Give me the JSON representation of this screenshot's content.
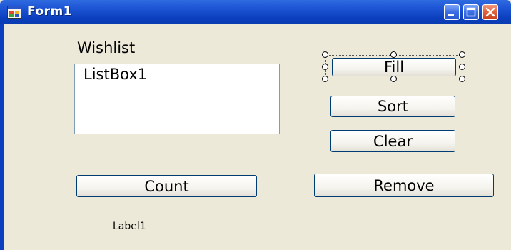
{
  "window": {
    "title": "Form1",
    "controls": [
      "minimize",
      "maximize",
      "close"
    ]
  },
  "form": {
    "wishlist_label": "Wishlist",
    "listbox_text": "ListBox1",
    "buttons": {
      "fill": "Fill",
      "sort": "Sort",
      "clear": "Clear",
      "count": "Count",
      "remove": "Remove"
    },
    "label1": "Label1",
    "selected_control": "fill-button"
  },
  "colors": {
    "title_bar": "#0b3fbe",
    "form_background": "#ECE9D8",
    "button_border": "#003c74",
    "close_button": "#e0603b"
  },
  "icons": [
    "form-icon",
    "minimize-icon",
    "maximize-icon",
    "close-icon"
  ]
}
